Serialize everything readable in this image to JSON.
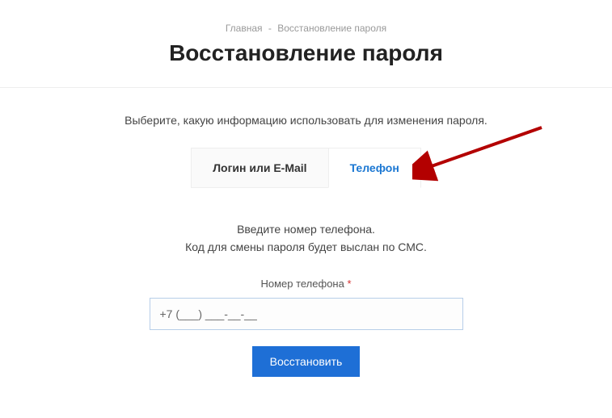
{
  "breadcrumb": {
    "home": "Главная",
    "separator": "-",
    "current": "Восстановление пароля"
  },
  "page_title": "Восстановление пароля",
  "instruction": "Выберите, какую информацию использовать для изменения пароля.",
  "tabs": {
    "login": "Логин или E-Mail",
    "phone": "Телефон"
  },
  "form": {
    "line1": "Введите номер телефона.",
    "line2": "Код для смены пароля будет выслан по СМС.",
    "phone_label": "Номер телефона",
    "required_mark": "*",
    "phone_value": "+7 (___) ___-__-__",
    "submit": "Восстановить"
  },
  "annotation": {
    "arrow_color": "#b30000"
  }
}
